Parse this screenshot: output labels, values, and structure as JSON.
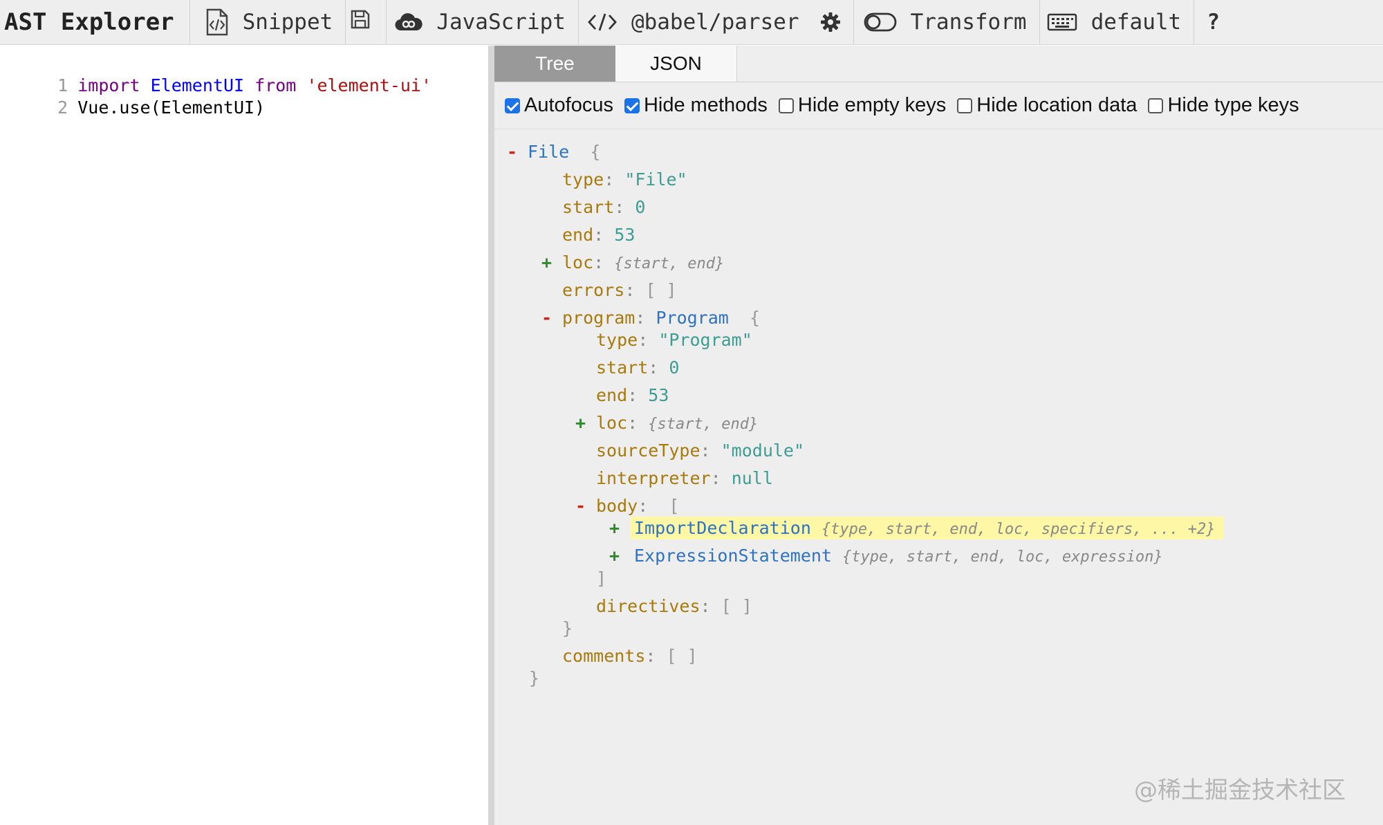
{
  "app": {
    "title": "AST Explorer"
  },
  "toolbar": {
    "snippet_label": "Snippet",
    "language_label": "JavaScript",
    "parser_label": "@babel/parser",
    "transform_label": "Transform",
    "keymap_label": "default",
    "help_label": "?"
  },
  "editor": {
    "lines": [
      {
        "num": "1",
        "tokens": [
          "import",
          "ElementUI",
          "from",
          "'element-ui'"
        ]
      },
      {
        "num": "2",
        "tokens": [
          "Vue.use(ElementUI)"
        ]
      }
    ]
  },
  "tabs": {
    "tree": "Tree",
    "json": "JSON"
  },
  "options": [
    {
      "label": "Autofocus",
      "checked": true
    },
    {
      "label": "Hide methods",
      "checked": true
    },
    {
      "label": "Hide empty keys",
      "checked": false
    },
    {
      "label": "Hide location data",
      "checked": false
    },
    {
      "label": "Hide type keys",
      "checked": false
    }
  ],
  "tree": {
    "root": {
      "name": "File",
      "open": "{",
      "close": "}"
    },
    "file_type": {
      "key": "type",
      "value": "\"File\""
    },
    "file_start": {
      "key": "start",
      "value": "0"
    },
    "file_end": {
      "key": "end",
      "value": "53"
    },
    "file_loc": {
      "key": "loc",
      "summary": "{start, end}"
    },
    "file_errors": {
      "key": "errors",
      "value": "[ ]"
    },
    "program": {
      "key": "program",
      "type": "Program",
      "open": "{",
      "close": "}"
    },
    "prog_type": {
      "key": "type",
      "value": "\"Program\""
    },
    "prog_start": {
      "key": "start",
      "value": "0"
    },
    "prog_end": {
      "key": "end",
      "value": "53"
    },
    "prog_loc": {
      "key": "loc",
      "summary": "{start, end}"
    },
    "prog_sourcetype": {
      "key": "sourceType",
      "value": "\"module\""
    },
    "prog_interpreter": {
      "key": "interpreter",
      "value": "null"
    },
    "body": {
      "key": "body",
      "open": "[",
      "close": "]"
    },
    "body_items": [
      {
        "type": "ImportDeclaration",
        "summary": "{type, start, end, loc, specifiers, ... +2}",
        "highlighted": true
      },
      {
        "type": "ExpressionStatement",
        "summary": "{type, start, end, loc, expression}",
        "highlighted": false
      }
    ],
    "prog_directives": {
      "key": "directives",
      "value": "[ ]"
    },
    "file_comments": {
      "key": "comments",
      "value": "[ ]"
    }
  },
  "colors": {
    "highlight": "#fdf7a6",
    "checkbox": "#1a73e8",
    "tab_active": "#999999"
  },
  "watermark": "@稀土掘金技术社区"
}
